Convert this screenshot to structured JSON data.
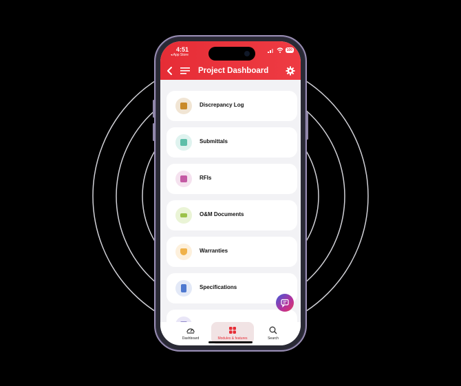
{
  "status": {
    "time": "4:51",
    "back_to_app": "◂ App Store",
    "battery": "100"
  },
  "header": {
    "title": "Project Dashboard"
  },
  "modules": [
    {
      "label": "Discrepancy Log",
      "icon": "clipboard-icon",
      "bg": "#f1e5d4",
      "fg": "#c98a2a"
    },
    {
      "label": "Submittals",
      "icon": "document-icon",
      "bg": "#dff3ef",
      "fg": "#5dbfa9"
    },
    {
      "label": "RFIs",
      "icon": "question-icon",
      "bg": "#f5e2ef",
      "fg": "#c45aa4"
    },
    {
      "label": "O&M Documents",
      "icon": "folder-icon",
      "bg": "#eaf4d6",
      "fg": "#9cc24a"
    },
    {
      "label": "Warranties",
      "icon": "shield-icon",
      "bg": "#fdf0dc",
      "fg": "#f0b24a"
    },
    {
      "label": "Specifications",
      "icon": "specs-icon",
      "bg": "#e3e9f7",
      "fg": "#4f79d0"
    },
    {
      "label": "",
      "icon": "module-icon",
      "bg": "#e9e6f7",
      "fg": "#8e86c9"
    }
  ],
  "tabs": [
    {
      "label": "Dashboard",
      "icon": "gauge-icon"
    },
    {
      "label": "Modules & features",
      "icon": "grid-icon"
    },
    {
      "label": "Search",
      "icon": "search-icon"
    }
  ],
  "colors": {
    "accent": "#e62d36",
    "background": "#000000",
    "ring": "#cfcfd6"
  }
}
